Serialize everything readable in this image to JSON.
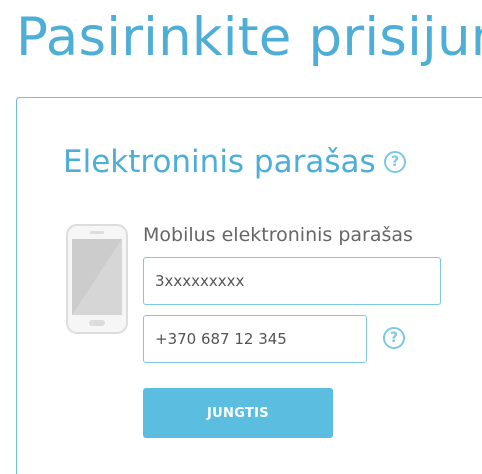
{
  "page": {
    "title": "Pasirinkite prisijung"
  },
  "card": {
    "section_title": "Elektroninis parašas",
    "help_symbol": "?"
  },
  "mobile_signature": {
    "label": "Mobilus elektroninis parašas",
    "code_input": {
      "value": "3xxxxxxxxx",
      "placeholder": "3xxxxxxxxx"
    },
    "phone_input": {
      "value": "+370 687 12 345",
      "placeholder": "+370 687 12 345"
    },
    "help_symbol": "?",
    "phone_icon": "mobile-phone-icon",
    "submit_label": "JUNGTIS"
  },
  "colors": {
    "accent": "#4eaed6",
    "border": "#7cc9e3",
    "button": "#5bbde0",
    "label_text": "#666666"
  }
}
